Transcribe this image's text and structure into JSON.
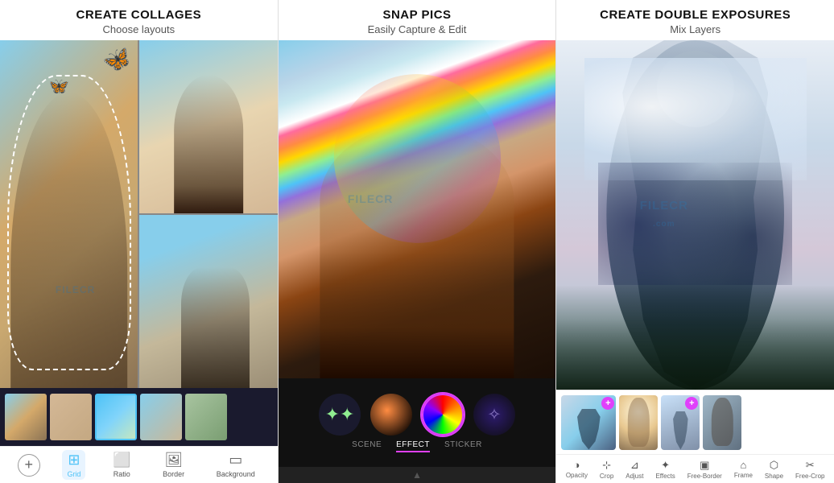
{
  "panels": [
    {
      "id": "collages",
      "title": "CREATE COLLAGES",
      "subtitle": "Choose layouts",
      "toolbar": {
        "add": "+",
        "items": [
          {
            "icon": "⊞",
            "label": "Grid",
            "active": true
          },
          {
            "icon": "⬜",
            "label": "Ratio",
            "active": false
          },
          {
            "icon": "🖼",
            "label": "Border",
            "active": false
          },
          {
            "icon": "▭",
            "label": "Background",
            "active": false
          }
        ]
      },
      "watermark": "FILECR"
    },
    {
      "id": "snap-pics",
      "title": "SNAP PICS",
      "subtitle": "Easily Capture & Edit",
      "effects": {
        "circles": [
          {
            "type": "stars",
            "label": "★"
          },
          {
            "type": "dark-gradient"
          },
          {
            "type": "rainbow",
            "selected": true
          },
          {
            "type": "sparkle"
          }
        ],
        "tabs": [
          {
            "label": "SCENE",
            "active": false
          },
          {
            "label": "EFFECT",
            "active": true
          },
          {
            "label": "STICKER",
            "active": false
          }
        ]
      },
      "watermark": "FILECR"
    },
    {
      "id": "double-exposure",
      "title": "CREATE DOUBLE EXPOSURES",
      "subtitle": "Mix Layers",
      "toolbar_items": [
        {
          "icon": "🌙",
          "label": "Opacity"
        },
        {
          "icon": "✂️",
          "label": "Crop"
        },
        {
          "icon": "🎨",
          "label": "Adjust"
        },
        {
          "icon": "✨",
          "label": "Effects"
        },
        {
          "icon": "🔲",
          "label": "Free-Border"
        },
        {
          "icon": "🏠",
          "label": "Frame"
        },
        {
          "icon": "⬡",
          "label": "Shape"
        },
        {
          "icon": "✂",
          "label": "Free-Crop"
        }
      ],
      "watermark": "FILECR\n.com"
    }
  ]
}
